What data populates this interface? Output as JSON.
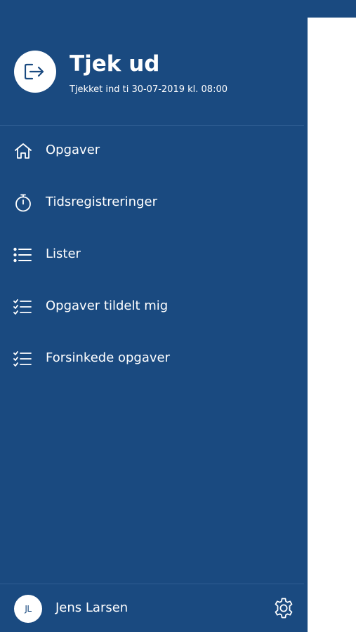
{
  "header": {
    "title": "Tjek ud",
    "subtitle": "Tjekket ind ti 30-07-2019 kl. 08:00",
    "icon": "sign-out-icon"
  },
  "menu": {
    "items": [
      {
        "label": "Opgaver",
        "icon": "home-icon"
      },
      {
        "label": "Tidsregistreringer",
        "icon": "stopwatch-icon"
      },
      {
        "label": "Lister",
        "icon": "list-icon"
      },
      {
        "label": "Opgaver tildelt mig",
        "icon": "checklist-icon"
      },
      {
        "label": "Forsinkede opgaver",
        "icon": "checklist-icon"
      }
    ]
  },
  "footer": {
    "initials": "JL",
    "user_name": "Jens Larsen",
    "settings_icon": "gear-icon"
  },
  "colors": {
    "drawer_background": "#1a4a80",
    "text": "#ffffff",
    "divider": "#2f5d92"
  }
}
